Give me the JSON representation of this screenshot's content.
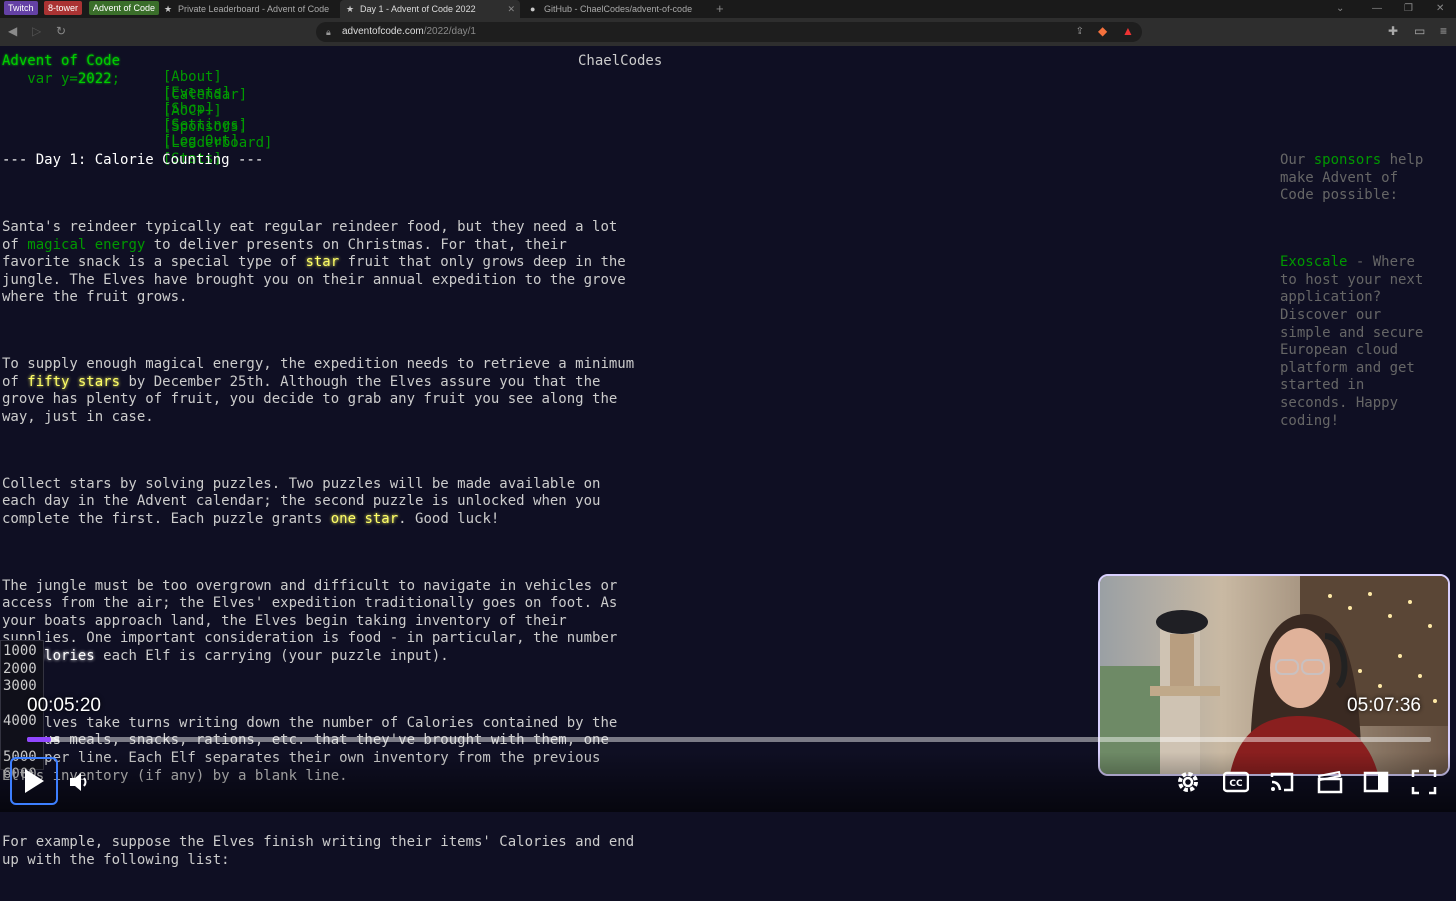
{
  "browser": {
    "pinned_tabs": [
      "Twitch",
      "8-tower",
      "Advent of Code"
    ],
    "tabs": [
      {
        "title": "Private Leaderboard - Advent of Code",
        "active": false
      },
      {
        "title": "Day 1 - Advent of Code 2022",
        "active": true
      },
      {
        "title": "GitHub - ChaelCodes/advent-of-code",
        "active": false
      }
    ],
    "new_tab": "+",
    "url_host": "adventofcode.com",
    "url_path": "/2022/day/1"
  },
  "site": {
    "title": "Advent of Code",
    "year_prefix": "   var y=",
    "year": "2022",
    "year_suffix": ";",
    "nav_row1": [
      "[About]",
      "[Events]",
      "[Shop]",
      "[Settings]",
      "[Log Out]"
    ],
    "nav_row2": [
      "[Calendar]",
      "[AoC++]",
      "[Sponsors]",
      "[Leaderboard]",
      "[Stats]"
    ],
    "user": "ChaelCodes"
  },
  "article": {
    "heading": "--- Day 1: Calorie Counting ---",
    "p1_a": "Santa's reindeer typically eat regular reindeer food, but they need a lot\nof ",
    "p1_link": "magical energy",
    "p1_b": " to deliver presents on Christmas. For that, their\nfavorite snack is a special type of ",
    "p1_star": "star",
    "p1_c": " fruit that only grows deep in the\njungle. The Elves have brought you on their annual expedition to the grove\nwhere the fruit grows.",
    "p2_a": "To supply enough magical energy, the expedition needs to retrieve a minimum\nof ",
    "p2_hl": "fifty stars",
    "p2_b": " by December 25th. Although the Elves assure you that the\ngrove has plenty of fruit, you decide to grab any fruit you see along the\nway, just in case.",
    "p3_a": "Collect stars by solving puzzles. Two puzzles will be made available on\neach day in the Advent calendar; the second puzzle is unlocked when you\ncomplete the first. Each puzzle grants ",
    "p3_hl": "one star",
    "p3_b": ". Good luck!",
    "p4_a": "The jungle must be too overgrown and difficult to navigate in vehicles or\naccess from the air; the Elves' expedition traditionally goes on foot. As\nyour boats approach land, the Elves begin taking inventory of their\nsupplies. One important consideration is food - in particular, the number\nof ",
    "p4_em": "Calories",
    "p4_b": " each Elf is carrying (your puzzle input).",
    "p5": "The Elves take turns writing down the number of Calories contained by the\nvarious meals, snacks, rations, etc. that they've brought with them, one\nitem per line. Each Elf separates their own inventory from the previous\nElf's inventory (if any) by a blank line.",
    "p6": "For example, suppose the Elves finish writing their items' Calories and end\nup with the following list:",
    "code": "1000\n2000\n3000\n\n4000\n\n5000\n6000"
  },
  "sidebar": {
    "intro_a": "Our ",
    "intro_link": "sponsors",
    "intro_b": " help\nmake Advent of\nCode possible:",
    "sponsor_name": "Exoscale",
    "sponsor_text": " - Where\nto host your next\napplication?\nDiscover our\nsimple and secure\nEuropean cloud\nplatform and get\nstarted in\nseconds. Happy\ncoding!"
  },
  "player": {
    "current_time": "00:05:20",
    "total_time": "05:07:36",
    "progress_fraction": 0.017,
    "accent": "#9147ff"
  }
}
